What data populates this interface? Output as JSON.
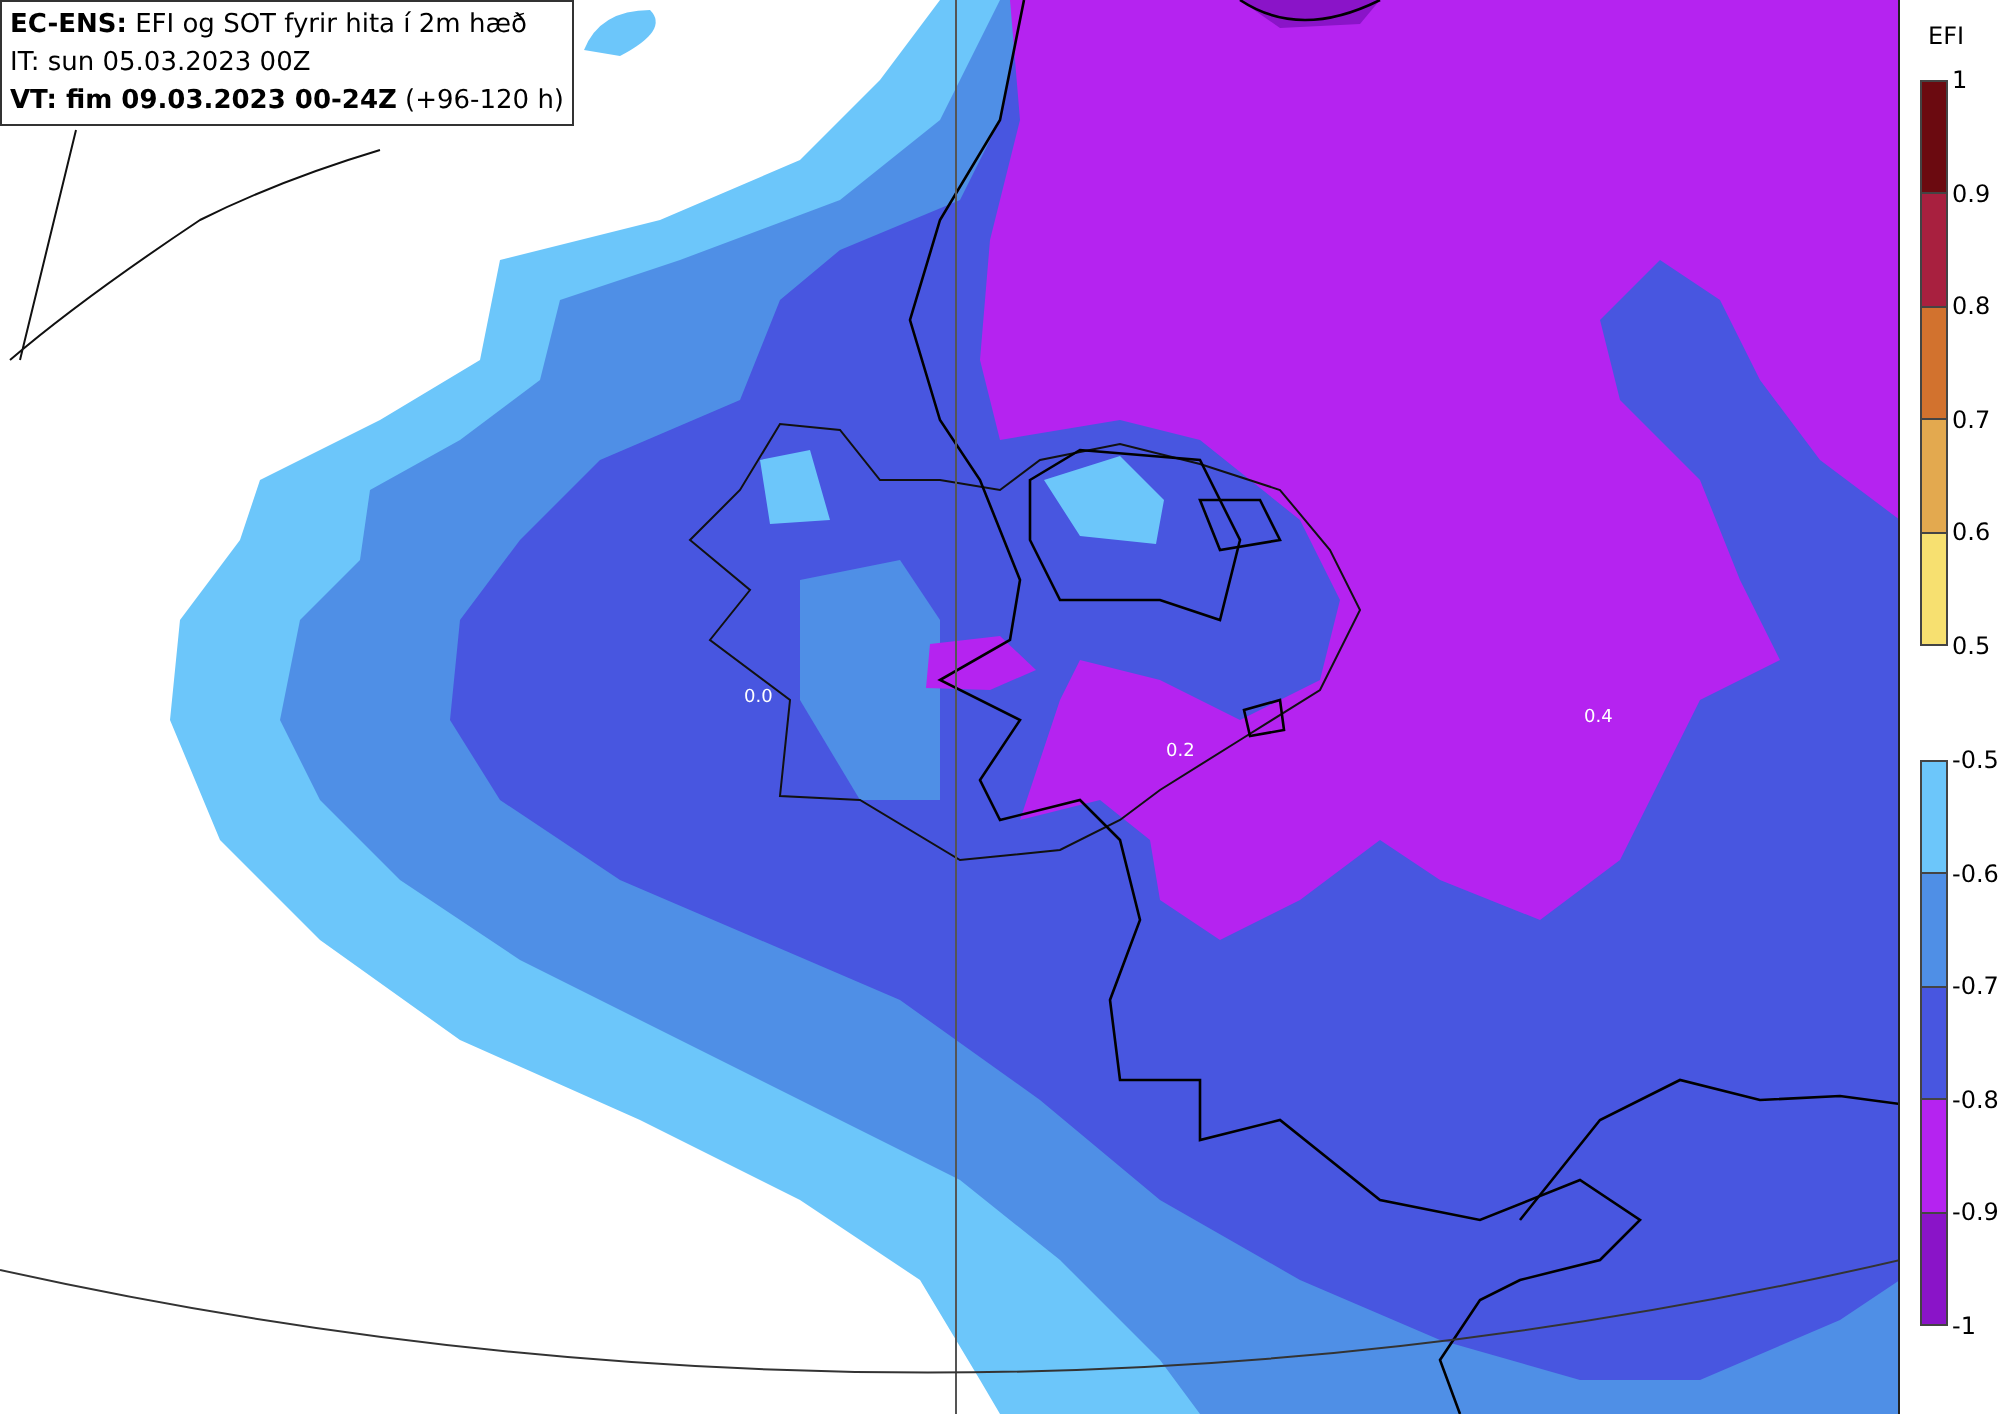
{
  "header": {
    "lines": [
      "**EC-ENS:** EFI og SOT fyrir hita í 2m hæð",
      "IT: sun 05.03.2023 00Z",
      "**VT: fim 09.03.2023 00-24Z** (+96-120 h)"
    ]
  },
  "map": {
    "contour_labels": [
      "0.0",
      "0.2",
      "0.4"
    ]
  },
  "colorbar": {
    "title": "EFI",
    "scales": [
      {
        "segments": [
          {
            "color": "#6b0a10"
          },
          {
            "color": "#a8203f"
          },
          {
            "color": "#d2722e"
          },
          {
            "color": "#e3a94f"
          },
          {
            "color": "#f7e070"
          }
        ],
        "ticks": [
          "1",
          "0.9",
          "0.8",
          "0.7",
          "0.6",
          "0.5"
        ]
      },
      {
        "segments": [
          {
            "color": "#6cc6fa"
          },
          {
            "color": "#4f8fe6"
          },
          {
            "color": "#4856e0"
          },
          {
            "color": "#b523f0"
          },
          {
            "color": "#8a14c8"
          }
        ],
        "ticks": [
          "-0.5",
          "-0.6",
          "-0.7",
          "-0.8",
          "-0.9",
          "-1"
        ]
      }
    ]
  }
}
